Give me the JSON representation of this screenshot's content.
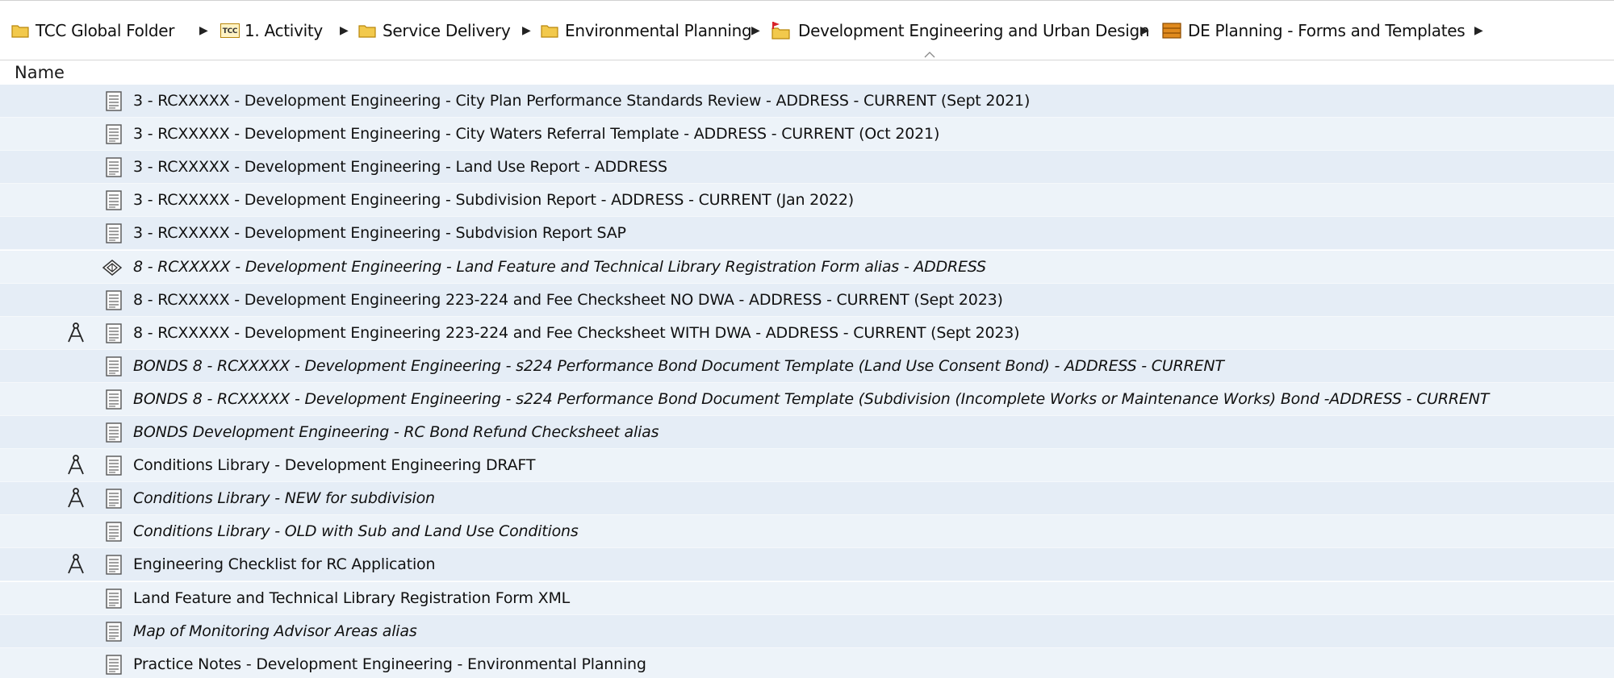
{
  "breadcrumb": {
    "items": [
      {
        "label": "TCC Global Folder",
        "icon": "folder-icon"
      },
      {
        "label": "1. Activity",
        "icon": "tcc-badge-icon",
        "badge": "TCC"
      },
      {
        "label": "Service Delivery",
        "icon": "folder-icon"
      },
      {
        "label": "Environmental Planning",
        "icon": "folder-icon"
      },
      {
        "label": "Development Engineering and Urban Design",
        "icon": "flagged-folder-icon"
      },
      {
        "label": "DE Planning - Forms and Templates",
        "icon": "cabinet-folder-icon"
      }
    ],
    "separator_icon": "chevron-right-icon"
  },
  "columns": {
    "name": "Name",
    "sort": "ascending"
  },
  "files": [
    {
      "name": "3 - RCXXXXX - Development Engineering - City Plan Performance Standards Review - ADDRESS - CURRENT (Sept 2021)",
      "italic": false,
      "icon": "document-icon",
      "status_icon": ""
    },
    {
      "name": "3 - RCXXXXX - Development Engineering - City Waters Referral Template - ADDRESS - CURRENT (Oct 2021)",
      "italic": false,
      "icon": "document-icon",
      "status_icon": ""
    },
    {
      "name": "3 - RCXXXXX - Development Engineering - Land Use Report - ADDRESS",
      "italic": false,
      "icon": "document-icon",
      "status_icon": ""
    },
    {
      "name": "3 - RCXXXXX - Development Engineering - Subdivision Report - ADDRESS - CURRENT (Jan 2022)",
      "italic": false,
      "icon": "document-icon",
      "status_icon": ""
    },
    {
      "name": "3 - RCXXXXX - Development Engineering - Subdvision Report SAP",
      "italic": false,
      "icon": "document-icon",
      "status_icon": ""
    },
    {
      "name": "8 - RCXXXXX - Development Engineering - Land Feature and Technical Library Registration Form alias - ADDRESS",
      "italic": true,
      "icon": "alias-shortcut-icon",
      "status_icon": ""
    },
    {
      "name": "8 - RCXXXXX - Development Engineering 223-224 and Fee Checksheet NO DWA - ADDRESS - CURRENT (Sept 2023)",
      "italic": false,
      "icon": "document-icon",
      "status_icon": ""
    },
    {
      "name": "8 - RCXXXXX - Development Engineering 223-224 and Fee Checksheet WITH DWA - ADDRESS - CURRENT (Sept 2023)",
      "italic": false,
      "icon": "document-icon",
      "status_icon": "compass-draft-icon"
    },
    {
      "name": "BONDS 8 - RCXXXXX - Development Engineering - s224 Performance Bond Document Template (Land Use Consent Bond) - ADDRESS - CURRENT",
      "italic": true,
      "icon": "document-icon",
      "status_icon": ""
    },
    {
      "name": "BONDS 8 - RCXXXXX - Development Engineering - s224 Performance Bond Document Template (Subdivision (Incomplete Works or Maintenance Works) Bond -ADDRESS - CURRENT",
      "italic": true,
      "icon": "document-icon",
      "status_icon": ""
    },
    {
      "name": "BONDS Development Engineering - RC Bond Refund Checksheet alias",
      "italic": true,
      "icon": "document-icon",
      "status_icon": ""
    },
    {
      "name": "Conditions Library - Development Engineering DRAFT",
      "italic": false,
      "icon": "document-icon",
      "status_icon": "compass-draft-icon"
    },
    {
      "name": "Conditions Library - NEW for subdivision",
      "italic": true,
      "icon": "document-icon",
      "status_icon": "compass-draft-icon"
    },
    {
      "name": "Conditions Library - OLD with Sub and Land Use Conditions",
      "italic": true,
      "icon": "document-icon",
      "status_icon": ""
    },
    {
      "name": "Engineering Checklist for RC Application",
      "italic": false,
      "icon": "document-icon",
      "status_icon": "compass-draft-icon"
    },
    {
      "name": "Land Feature and Technical Library Registration Form XML",
      "italic": false,
      "icon": "document-icon",
      "status_icon": ""
    },
    {
      "name": "Map of Monitoring Advisor Areas alias",
      "italic": true,
      "icon": "document-icon",
      "status_icon": ""
    },
    {
      "name": "Practice Notes - Development Engineering - Environmental Planning",
      "italic": false,
      "icon": "document-icon",
      "status_icon": ""
    }
  ],
  "colors": {
    "row_even": "#e5edf6",
    "row_odd": "#edf3f9",
    "folder_yellow": "#f2c94c",
    "folder_outline": "#b8860b",
    "cabinet_orange": "#e08a1e",
    "flag_red": "#d8232a"
  }
}
